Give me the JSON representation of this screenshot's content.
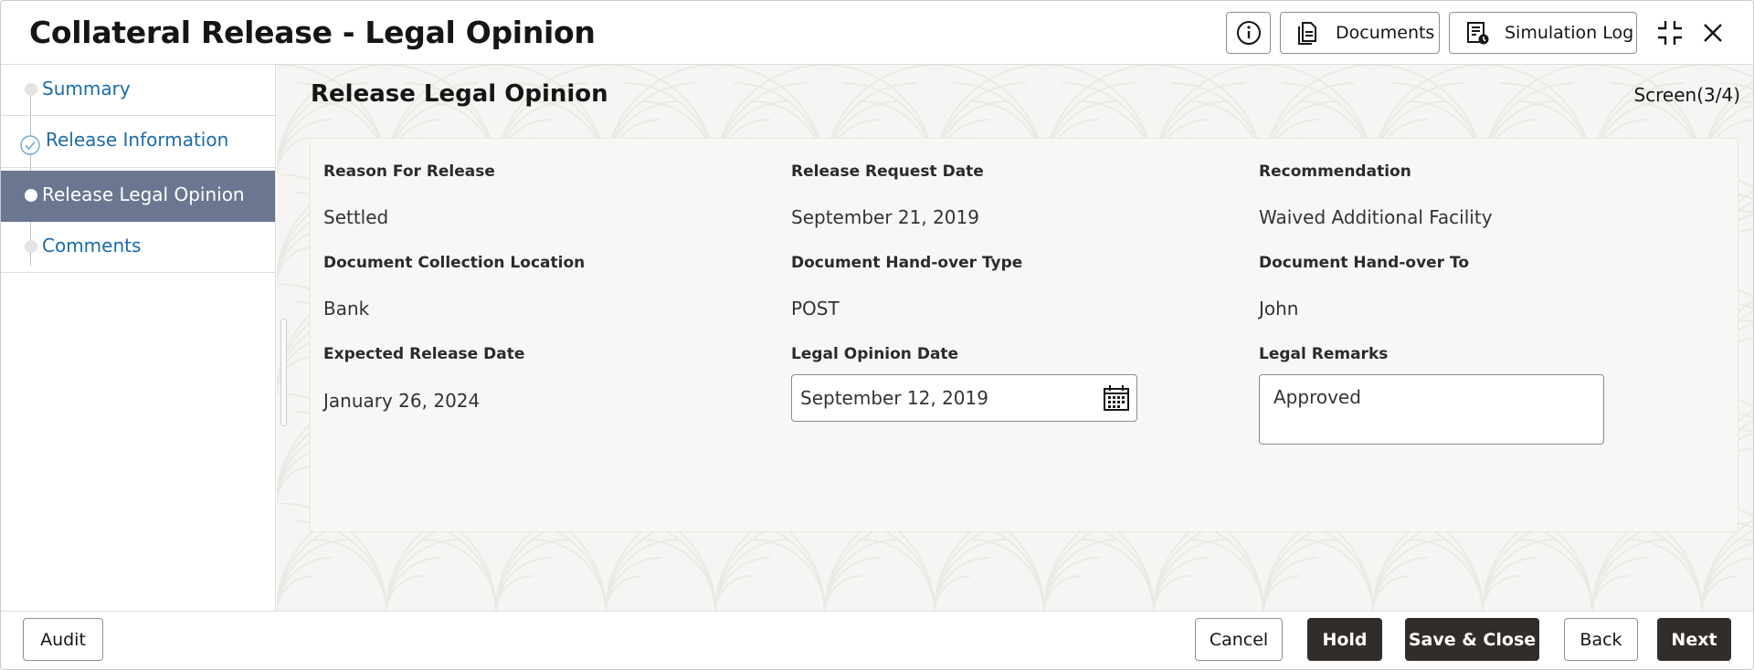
{
  "header": {
    "title": "Collateral Release - Legal Opinion",
    "documents_label": "Documents",
    "simulation_log_label": "Simulation Log",
    "icons": [
      "info-icon",
      "document-icon",
      "simulation-log-icon",
      "minimize-icon",
      "close-icon"
    ]
  },
  "sidebar": {
    "items": [
      {
        "label": "Summary",
        "state": "pending"
      },
      {
        "label": "Release Information",
        "state": "completed"
      },
      {
        "label": "Release Legal Opinion",
        "state": "active"
      },
      {
        "label": "Comments",
        "state": "pending"
      }
    ]
  },
  "main": {
    "section_title": "Release Legal Opinion",
    "screen_count": "Screen(3/4)",
    "fields": {
      "reason_for_release": {
        "label": "Reason For Release",
        "value": "Settled"
      },
      "release_request_date": {
        "label": "Release Request Date",
        "value": "September 21, 2019"
      },
      "recommendation": {
        "label": "Recommendation",
        "value": "Waived Additional Facility"
      },
      "document_collection_location": {
        "label": "Document Collection Location",
        "value": "Bank"
      },
      "document_handover_type": {
        "label": "Document Hand-over Type",
        "value": "POST"
      },
      "document_handover_to": {
        "label": "Document Hand-over To",
        "value": "John"
      },
      "expected_release_date": {
        "label": "Expected Release Date",
        "value": "January 26, 2024"
      },
      "legal_opinion_date": {
        "label": "Legal Opinion Date",
        "value": "September 12, 2019"
      },
      "legal_remarks": {
        "label": "Legal Remarks",
        "value": "Approved"
      }
    }
  },
  "footer": {
    "audit": "Audit",
    "cancel": "Cancel",
    "hold": "Hold",
    "save_close": "Save & Close",
    "back": "Back",
    "next": "Next"
  },
  "colors": {
    "active_nav_bg": "#6b7690",
    "nav_link": "#1b6ba8",
    "dark_button": "#312d2a",
    "content_bg": "#f6f5f3"
  }
}
